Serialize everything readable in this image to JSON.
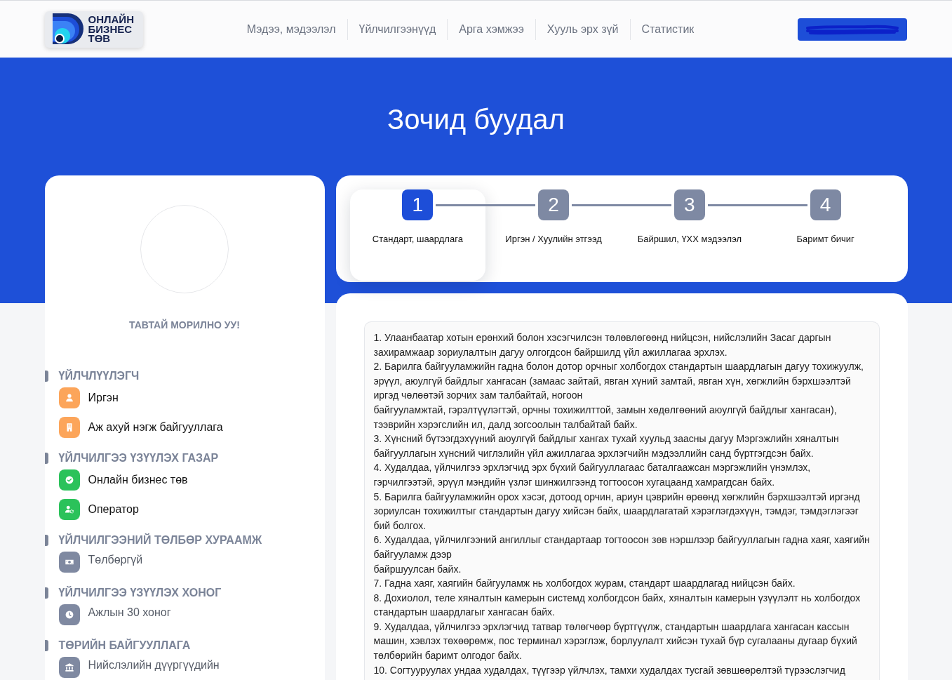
{
  "header": {
    "logo": {
      "lines": [
        "ОНЛАЙН",
        "БИЗНЕС",
        "ТӨВ"
      ]
    },
    "nav": [
      "Мэдээ, мэдээлэл",
      "Үйлчилгээнүүд",
      "Арга хэмжээ",
      "Хууль эрх зүй",
      "Статистик"
    ],
    "account_button": {
      "redacted": true
    }
  },
  "hero": {
    "title": "Зочид буудал"
  },
  "profile": {
    "welcome": "ТАВТАЙ МОРИЛНО УУ!",
    "sections": [
      {
        "title": "ҮЙЛЧЛҮҮЛЭГЧ",
        "items": [
          {
            "label": "Иргэн",
            "kind": "citizen",
            "color": "#fca55a",
            "muted": false
          },
          {
            "label": "Аж ахуй нэгж байгууллага",
            "kind": "organization",
            "color": "#fca55a",
            "muted": false
          }
        ]
      },
      {
        "title": "ҮЙЛЧИЛГЭЭ ҮЗҮҮЛЭХ ГАЗАР",
        "items": [
          {
            "label": "Онлайн бизнес төв",
            "kind": "online",
            "color": "#2bc25a",
            "muted": false
          },
          {
            "label": "Оператор",
            "kind": "operator",
            "color": "#2bc25a",
            "muted": false
          }
        ]
      },
      {
        "title": "ҮЙЛЧИЛГЭЭНИЙ ТӨЛБӨР ХУРААМЖ",
        "items": [
          {
            "label": "Төлбөргүй",
            "kind": "fee",
            "color": "#7f89a1",
            "muted": true
          }
        ]
      },
      {
        "title": "ҮЙЛЧИЛГЭЭ ҮЗҮҮЛЭХ ХОНОГ",
        "items": [
          {
            "label": "Ажлын 30 хоног",
            "kind": "duration",
            "color": "#7f89a1",
            "muted": true
          }
        ]
      },
      {
        "title": "ТӨРИЙН БАЙГУУЛЛАГА",
        "items": [
          {
            "label": "Нийслэлийн дүүргүүдийн",
            "kind": "government",
            "color": "#7f89a1",
            "muted": true
          }
        ]
      }
    ]
  },
  "steps": [
    {
      "number": "1",
      "label": "Стандарт, шаардлага",
      "selected": true
    },
    {
      "number": "2",
      "label": "Иргэн / Хуулийн этгээд",
      "selected": false
    },
    {
      "number": "3",
      "label": "Байршил, ҮХХ мэдээлэл",
      "selected": false
    },
    {
      "number": "4",
      "label": "Баримт бичиг",
      "selected": false
    }
  ],
  "requirements": {
    "items": [
      "1. Улаанбаатар хотын ерөнхий болон хэсэгчилсэн төлөвлөгөөнд нийцсэн, нийслэлийн Засаг даргын захирамжаар зориулалтын дагуу олгогдсон байршилд үйл ажиллагаа эрхлэх.",
      "2. Барилга байгууламжийн гадна болон дотор орчныг холбогдох стандартын шаардлагын дагуу тохижуулж, эрүүл, аюулгүй байдлыг хангасан (замаас зайтай, явган хүний замтай, явган хүн, хөгжлийн бэрхшээлтэй иргэд чөлөөтэй зорчих зам талбайтай, ногоон\nбайгууламжтай, гэрэлтүүлэгтэй, орчны тохижилттой, замын хөдөлгөөний аюулгүй байдлыг хангасан), тээврийн хэрэгслийн ил, далд зогсоолын талбайтай байх.",
      "3. Хүнсний бүтээгдэхүүний аюулгүй байдлыг хангах тухай хуульд заасны дагуу Мэргэжлийн хяналтын байгууллагын хүнсний чиглэлийн үйл ажиллагаа эрхлэгчийн мэдээллийн санд бүртгэгдсэн байх.",
      "4. Худалдаа, үйлчилгээ эрхлэгчид эрх бүхий байгууллагаас баталгаажсан мэргэжлийн үнэмлэх, гэрчилгээтэй, эрүүл мэндийн үзлэг шинжилгээнд тогтоосон хугацаанд хамрагдсан байх.",
      "5. Барилга байгууламжийн орох хэсэг, дотоод орчин, ариун цэврийн өрөөнд хөгжлийн бэрхшээлтэй иргэнд зориулсан тохижилтыг стандартын дагуу хийсэн байх, шаардлагатай хэрэглэгдэхүүн, тэмдэг, тэмдэглэгээг бий болгох.",
      "6. Худалдаа, үйлчилгээний ангиллыг стандартаар тогтоосон зөв нэршлээр байгууллагын гадна хаяг, хаягийн байгууламж дээр\nбайршуулсан байх.",
      "7. Гадна хаяг, хаягийн байгууламж нь холбогдох журам, стандарт шаардлагад нийцсэн байх.",
      "8. Дохиолол, теле хяналтын камерын системд холбогдсон байх, хяналтын камерын үзүүлэлт нь холбогдох стандартын шаардлагыг хангасан байх.",
      "9. Худалдаа, үйлчилгээ эрхлэгчид татвар төлөгчөөр бүртгүүлж, стандартын шаардлага хангасан кассын машин, хэвлэх төхөөрөмж, пос терминал хэрэглэж, борлуулалт хийсэн тухай бүр сугалааны дугаар бүхий төлбөрийн баримт олгодог байх.",
      "10. Согтууруулах ундаа худалдах, түүгээр үйлчлэх, тамхи худалдах тусгай зөвшөөрөлтэй түрээслэгчид"
    ]
  }
}
